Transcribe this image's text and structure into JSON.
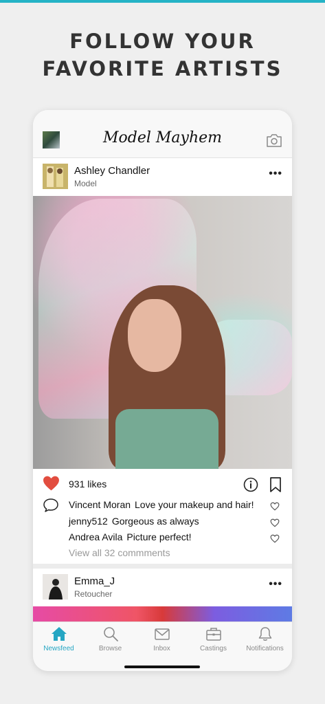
{
  "headline": {
    "line1": "FOLLOW YOUR",
    "line2": "FAVORITE ARTISTS"
  },
  "app": {
    "logo": "Model Mayhem"
  },
  "posts": [
    {
      "user": "Ashley Chandler",
      "role": "Model",
      "likes": "931 likes",
      "comments": [
        {
          "user": "Vincent Moran",
          "text": "Love your makeup and hair!"
        },
        {
          "user": "jenny512",
          "text": "Gorgeous as always"
        },
        {
          "user": "Andrea Avila",
          "text": "Picture perfect!"
        }
      ],
      "view_all": "View all 32 commments"
    },
    {
      "user": "Emma_J",
      "role": "Retoucher"
    }
  ],
  "tabs": [
    {
      "label": "Newsfeed",
      "icon": "home-icon",
      "active": true
    },
    {
      "label": "Browse",
      "icon": "search-icon"
    },
    {
      "label": "Inbox",
      "icon": "mail-icon"
    },
    {
      "label": "Castings",
      "icon": "briefcase-icon"
    },
    {
      "label": "Notifications",
      "icon": "bell-icon"
    }
  ],
  "colors": {
    "accent": "#25b3c6",
    "like": "#e24d3f",
    "headline": "#333333"
  }
}
